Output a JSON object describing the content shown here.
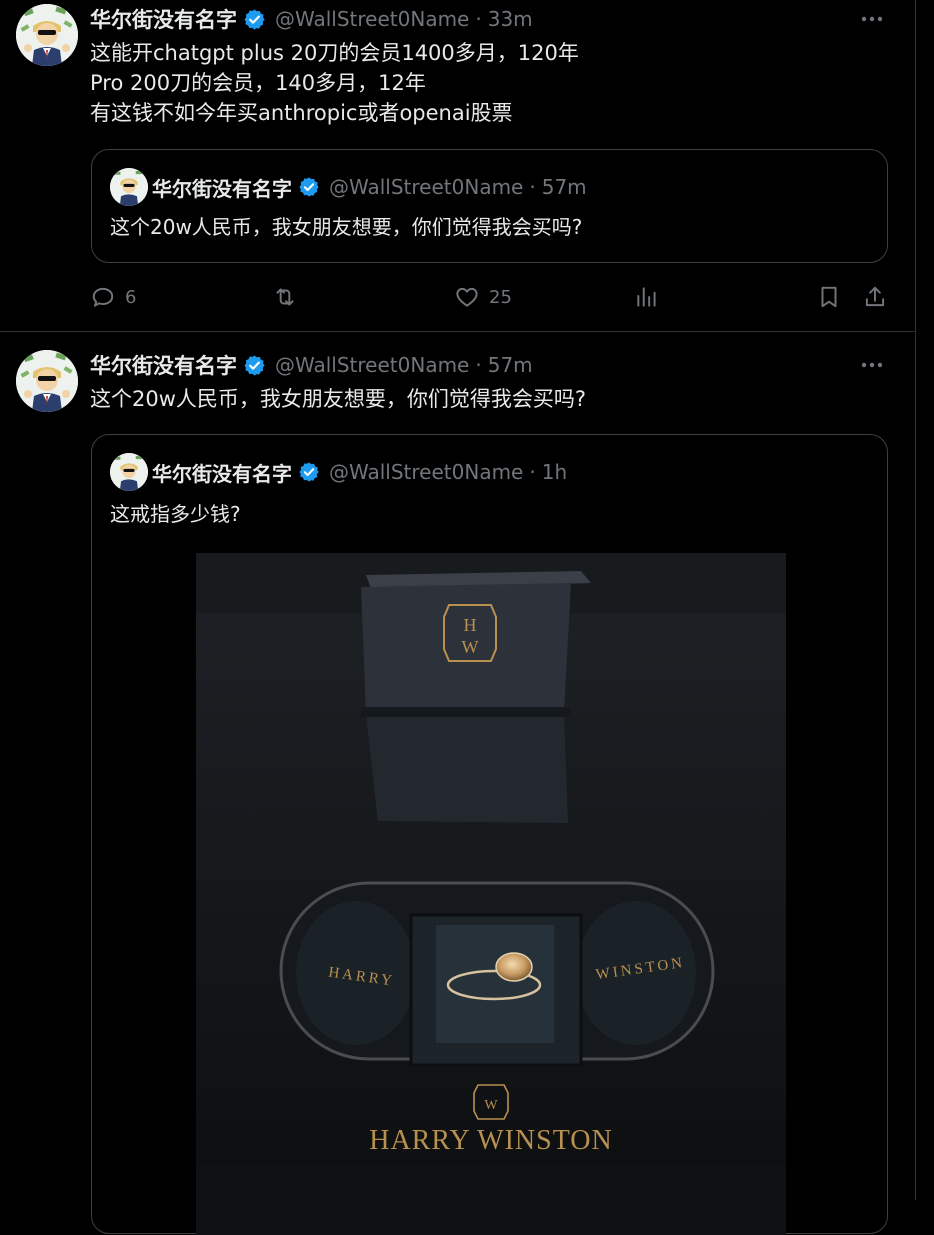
{
  "tweets": [
    {
      "author": {
        "name": "华尔街没有名字",
        "handle": "@WallStreet0Name",
        "time": "33m"
      },
      "lines": [
        "这能开chatgpt plus 20刀的会员1400多月，120年",
        "Pro 200刀的会员，140多月，12年",
        "有这钱不如今年买anthropic或者openai股票"
      ],
      "quote": {
        "author": {
          "name": "华尔街没有名字",
          "handle": "@WallStreet0Name",
          "time": "57m"
        },
        "text": "这个20w人民币，我女朋友想要，你们觉得我会买吗?"
      },
      "actions": {
        "replies": "6",
        "retweets": "",
        "likes": "25",
        "views": ""
      }
    },
    {
      "author": {
        "name": "华尔街没有名字",
        "handle": "@WallStreet0Name",
        "time": "57m"
      },
      "lines": [
        "这个20w人民币，我女朋友想要，你们觉得我会买吗?"
      ],
      "quote": {
        "author": {
          "name": "华尔街没有名字",
          "handle": "@WallStreet0Name",
          "time": "1h"
        },
        "text": "这戒指多少钱?"
      }
    }
  ],
  "photo": {
    "box_monogram_top": "H",
    "box_monogram_bottom": "W",
    "lid_left": "HARRY",
    "lid_right": "WINSTON",
    "brand_text": "HARRY WINSTON"
  },
  "colors": {
    "background": "#000000",
    "text": "#e7e9ea",
    "muted": "#71767b",
    "verified": "#1d9bf0",
    "border": "#2f3336",
    "gold": "#b8904f"
  },
  "icons": [
    "more-icon",
    "verified-icon",
    "reply-icon",
    "retweet-icon",
    "like-icon",
    "views-icon",
    "bookmark-icon",
    "share-icon"
  ]
}
